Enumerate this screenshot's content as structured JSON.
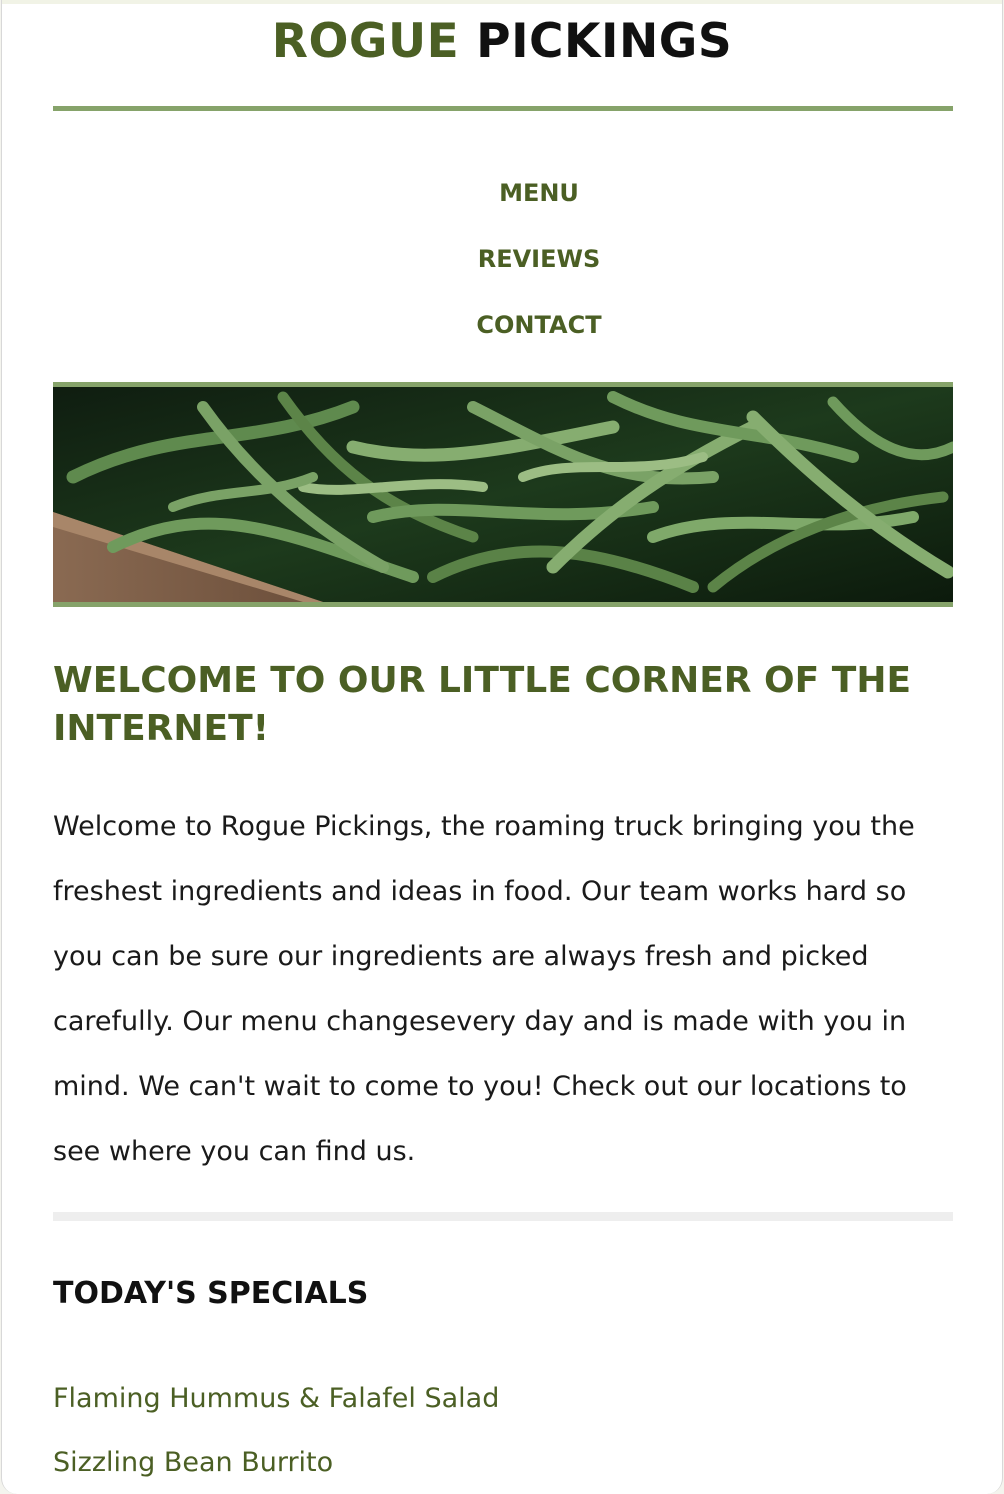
{
  "brand": {
    "name_first": "ROGUE",
    "name_second": "PICKINGS"
  },
  "nav": {
    "items": [
      {
        "label": "MENU"
      },
      {
        "label": "REVIEWS"
      },
      {
        "label": "CONTACT"
      }
    ]
  },
  "hero": {
    "image_subject": "green beans in a wooden crate"
  },
  "welcome": {
    "title": "WELCOME TO OUR LITTLE CORNER OF THE INTERNET!",
    "body": "Welcome to Rogue Pickings, the roaming truck bringing you the freshest ingredients and ideas in food. Our team works hard so you can be sure our ingredients are always fresh and picked carefully. Our menu changesevery day and is made with you in mind. We can't wait to come to you! Check out our locations to see where you can find us."
  },
  "specials": {
    "title": "TODAY'S SPECIALS",
    "items": [
      {
        "name": "Flaming Hummus & Falafel Salad"
      },
      {
        "name": "Sizzling Bean Burrito"
      }
    ]
  },
  "colors": {
    "brand_green": "#4b5f24",
    "accent_green": "#86a36a",
    "text_dark": "#111111"
  }
}
